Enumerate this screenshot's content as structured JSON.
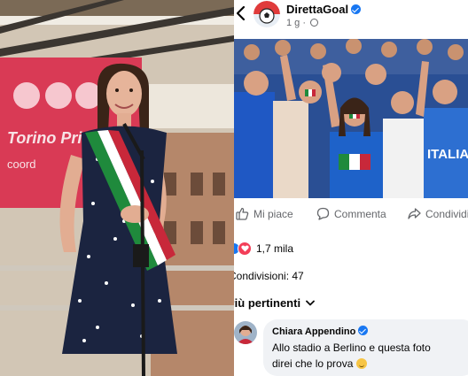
{
  "left_photo": {
    "banner_text": "Torino Pride",
    "banner_subtext": "coord",
    "banner_color": "#d93a55"
  },
  "post": {
    "page_name": "DirettaGoal",
    "timestamp": "1 g · ",
    "photo_label": "Italy football fans in stadium",
    "actions": {
      "like": "Mi piace",
      "comment": "Commenta",
      "share": "Condividi"
    },
    "reactions_count": "1,7 mila",
    "shares": "Condivisioni: 47",
    "sort_label": "Più pertinenti"
  },
  "comment": {
    "author": "Chiara Appendino",
    "text": "Allo stadio a Berlino e questa foto direi che lo prova"
  },
  "colors": {
    "accent": "#1877f2",
    "heart": "#f33e58",
    "secondary_text": "#65676b",
    "bubble": "#f0f2f5"
  }
}
